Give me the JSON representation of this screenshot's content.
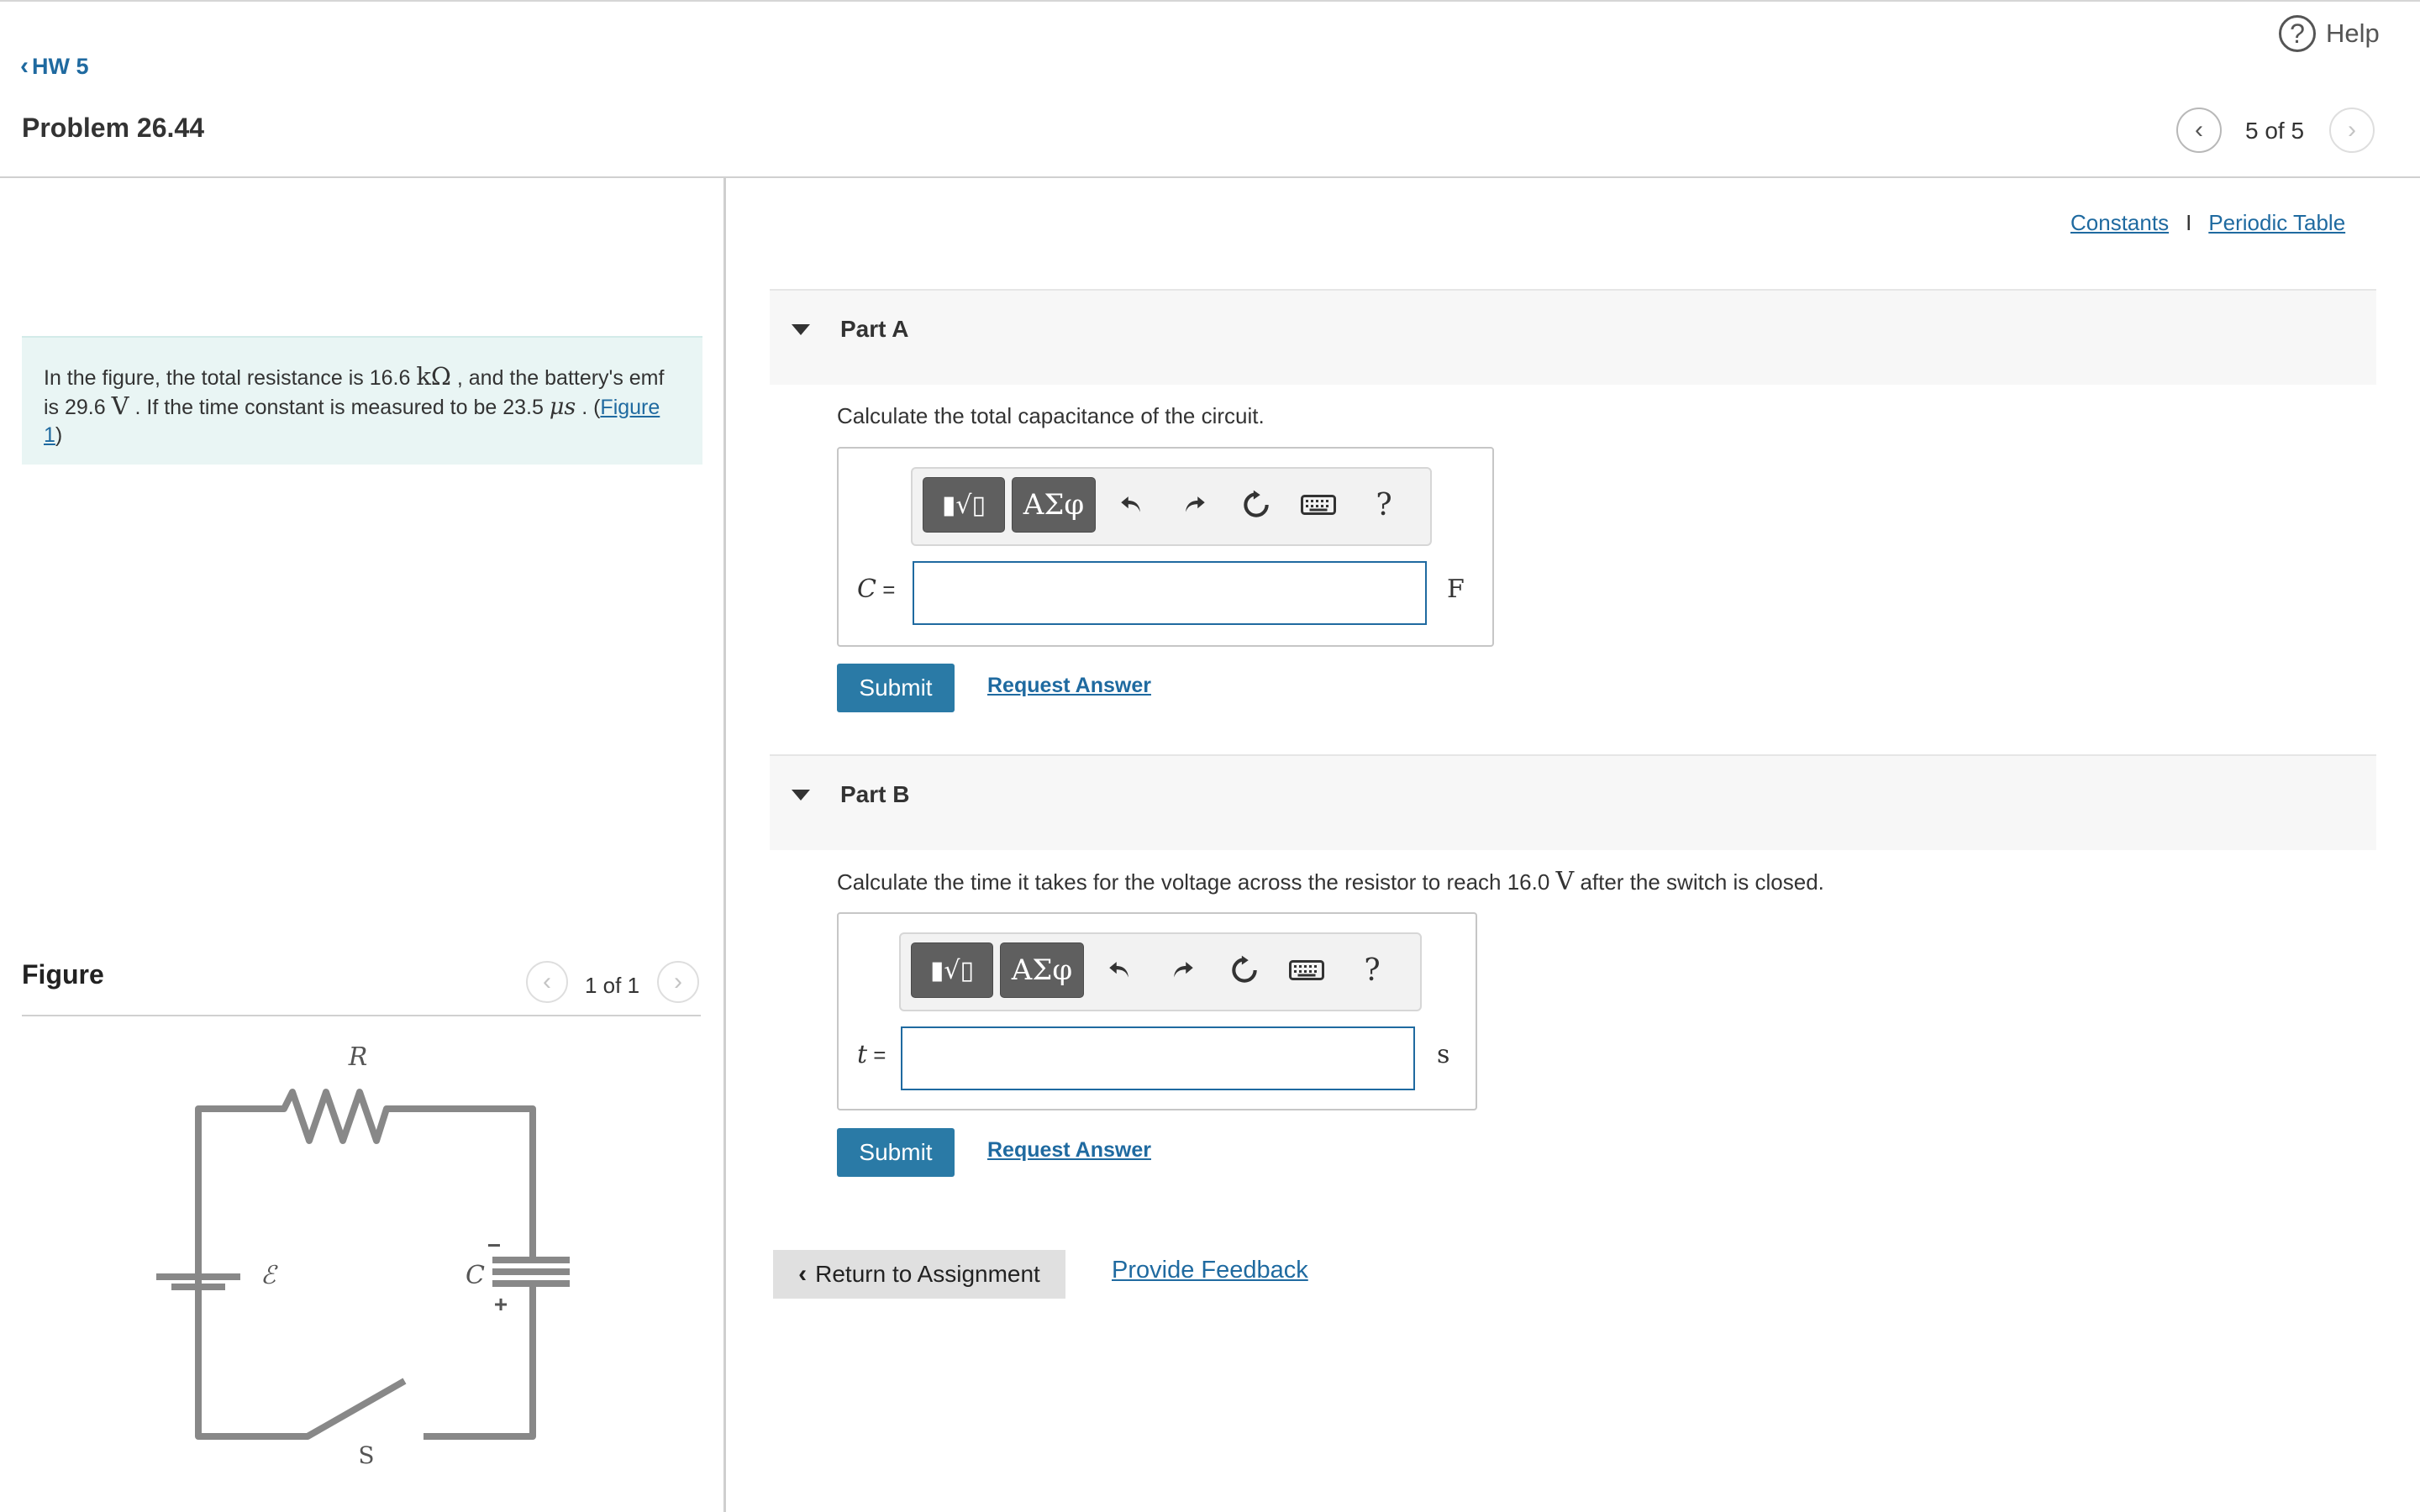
{
  "header": {
    "help_label": "Help",
    "help_glyph": "?",
    "back_label": "HW 5",
    "problem_title": "Problem 26.44",
    "pager_text": "5 of 5"
  },
  "intro": {
    "t1": "In the figure, the total resistance is 16.6 ",
    "s1": "kΩ",
    "t2": " , and the battery's emf is 29.6 ",
    "s2": "V",
    "t3": " . If the time constant is measured to be 23.5 ",
    "s3": "μs",
    "t4": " . (",
    "figure_link": "Figure 1",
    "t5": ")"
  },
  "figure": {
    "label": "Figure",
    "pager_text": "1 of 1",
    "circuit_labels": {
      "resistor": "R",
      "emf": "ℰ",
      "capacitor": "C",
      "switch": "S",
      "minus": "−",
      "plus": "+"
    }
  },
  "links": {
    "constants": "Constants",
    "separator": "I",
    "periodic_table": "Periodic Table"
  },
  "toolbar": {
    "templates_glyph": "▮√▯",
    "greek_glyph": "ΑΣφ",
    "help_glyph": "?"
  },
  "partA": {
    "title": "Part A",
    "prompt": "Calculate the total capacitance of the circuit.",
    "var": "C",
    "eq": " =",
    "unit": "F",
    "input_value": "",
    "submit": "Submit",
    "request": "Request Answer"
  },
  "partB": {
    "title": "Part B",
    "prompt_t1": "Calculate the time it takes for the voltage across the resistor to reach 16.0 ",
    "prompt_sym": "V",
    "prompt_t2": " after the switch is closed.",
    "var": "t",
    "eq": " =",
    "unit": "s",
    "input_value": "",
    "submit": "Submit",
    "request": "Request Answer"
  },
  "footer": {
    "return_label": "Return to Assignment",
    "feedback_label": "Provide Feedback"
  }
}
